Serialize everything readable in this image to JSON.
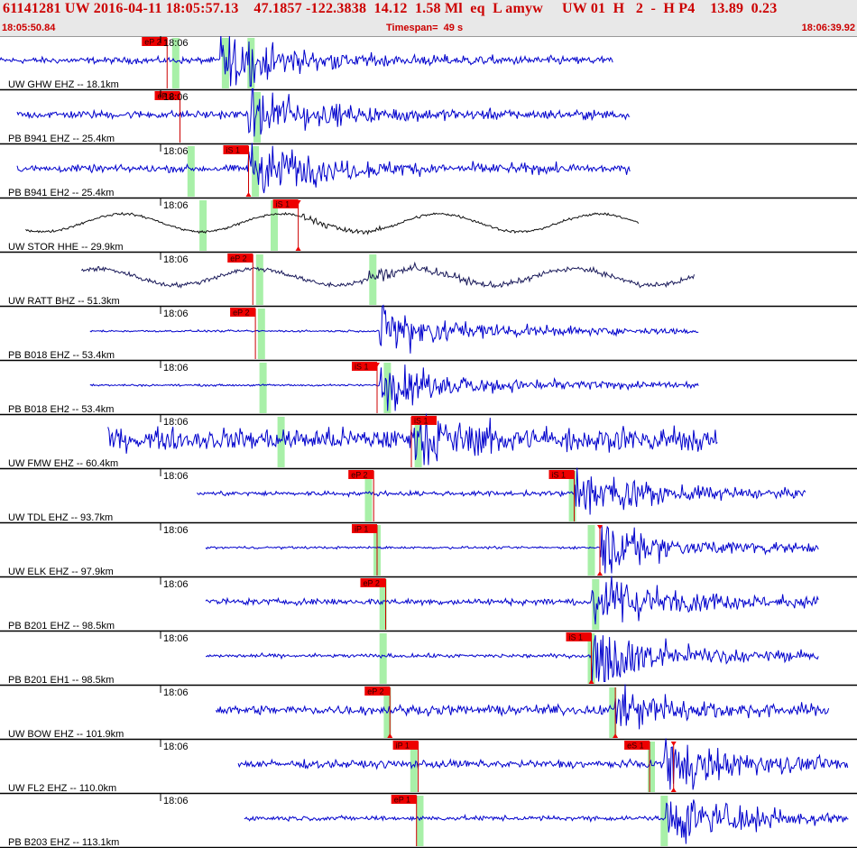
{
  "header": {
    "event_line": "61141281 UW 2016-04-11 18:05:57.13    47.1857 -122.3838  14.12  1.58 Ml  eq  L amyw     UW 01  H   2  -  H P4    13.89  0.23",
    "start_time": "18:05:50.84",
    "timespan": "Timespan=  49 s",
    "end_time": "18:06:39.92"
  },
  "colors": {
    "header_text": "#cc0000",
    "seismogram_blue": "#0000cc",
    "seismogram_dark": "#1a1a5a",
    "seismogram_black": "#111111",
    "pick_fill": "#ee0000",
    "window_green": "#a8f0a8"
  },
  "traces": [
    {
      "station": "UW GHW EHZ --",
      "dist": "18.1km",
      "label": "UW GHW EHZ -- 18.1km",
      "time": "18:06",
      "color": "blue",
      "start": 0.0,
      "end": 0.715,
      "onset": 0.257,
      "amp": 0.45,
      "noise": 0.08,
      "slow": 0,
      "greens": [
        0.205,
        0.263,
        0.293
      ],
      "picks": [
        {
          "text": "eP 2",
          "t": 0.195,
          "side": "left"
        }
      ]
    },
    {
      "station": "PB B941 EHZ --",
      "dist": "25.4km",
      "label": "PB B941 EHZ -- 25.4km",
      "time": "18:06",
      "color": "blue",
      "start": 0.02,
      "end": 0.735,
      "onset": 0.29,
      "amp": 0.4,
      "noise": 0.1,
      "slow": 0,
      "greens": [
        0.3
      ],
      "picks": [
        {
          "text": "eP 2",
          "t": 0.21,
          "side": "left"
        }
      ]
    },
    {
      "station": "PB B941 EH2 --",
      "dist": "25.4km",
      "label": "PB B941 EH2 -- 25.4km",
      "time": "18:06",
      "color": "blue",
      "start": 0.02,
      "end": 0.735,
      "onset": 0.29,
      "amp": 0.45,
      "noise": 0.09,
      "slow": 0,
      "greens": [
        0.223,
        0.298
      ],
      "picks": [
        {
          "text": "iS 1",
          "t": 0.29,
          "side": "left",
          "marker": "below"
        }
      ]
    },
    {
      "station": "UW STOR HHE --",
      "dist": "29.9km",
      "label": "UW STOR HHE -- 29.9km",
      "time": "18:06",
      "color": "black",
      "start": 0.03,
      "end": 0.745,
      "onset": 0.35,
      "amp": 0.06,
      "noise": 0.03,
      "slow": 0.33,
      "greens": [
        0.237,
        0.32
      ],
      "picks": [
        {
          "text": "iS 1",
          "t": 0.348,
          "side": "left",
          "marker": "both"
        }
      ]
    },
    {
      "station": "UW RATT BHZ --",
      "dist": "51.3km",
      "label": "UW RATT BHZ -- 51.3km",
      "time": "18:06",
      "color": "dark",
      "start": 0.095,
      "end": 0.81,
      "onset": 0.43,
      "amp": 0.12,
      "noise": 0.06,
      "slow": 0.3,
      "greens": [
        0.303,
        0.435
      ],
      "picks": [
        {
          "text": "eP 2",
          "t": 0.295,
          "side": "left"
        }
      ]
    },
    {
      "station": "PB B018 EHZ --",
      "dist": "53.4km",
      "label": "PB B018 EHZ -- 53.4km",
      "time": "18:06",
      "color": "blue",
      "start": 0.105,
      "end": 0.815,
      "onset": 0.443,
      "amp": 0.38,
      "noise": 0.025,
      "slow": 0,
      "greens": [
        0.305
      ],
      "picks": [
        {
          "text": "eP 2",
          "t": 0.298,
          "side": "left"
        }
      ]
    },
    {
      "station": "PB B018 EH2 --",
      "dist": "53.4km",
      "label": "PB B018 EH2 -- 53.4km",
      "time": "18:06",
      "color": "blue",
      "start": 0.105,
      "end": 0.815,
      "onset": 0.443,
      "amp": 0.4,
      "noise": 0.025,
      "slow": 0,
      "greens": [
        0.307,
        0.452
      ],
      "picks": [
        {
          "text": "iS 1",
          "t": 0.44,
          "side": "left",
          "marker": "above"
        }
      ]
    },
    {
      "station": "UW FMW EHZ --",
      "dist": "60.4km",
      "label": "UW FMW EHZ -- 60.4km",
      "time": "18:06",
      "color": "blue",
      "start": 0.126,
      "end": 0.838,
      "onset": 0.48,
      "amp": 0.4,
      "noise": 0.28,
      "slow": 0,
      "greens": [
        0.328,
        0.488
      ],
      "picks": [
        {
          "text": "iS 1",
          "t": 0.48,
          "side": "right"
        }
      ]
    },
    {
      "station": "UW TDL EHZ --",
      "dist": "93.7km",
      "label": "UW TDL EHZ -- 93.7km",
      "time": "18:06",
      "color": "blue",
      "start": 0.23,
      "end": 0.94,
      "onset": 0.67,
      "amp": 0.4,
      "noise": 0.06,
      "slow": 0,
      "greens": [
        0.43,
        0.668
      ],
      "picks": [
        {
          "text": "eP 2",
          "t": 0.436,
          "side": "left"
        },
        {
          "text": "iS 1",
          "t": 0.67,
          "side": "left"
        }
      ]
    },
    {
      "station": "UW ELK EHZ --",
      "dist": "97.9km",
      "label": "UW ELK EHZ -- 97.9km",
      "time": "18:06",
      "color": "blue",
      "start": 0.24,
      "end": 0.955,
      "onset": 0.7,
      "amp": 0.42,
      "noise": 0.03,
      "slow": 0,
      "greens": [
        0.44,
        0.69
      ],
      "picks": [
        {
          "text": "iP 1",
          "t": 0.44,
          "side": "left"
        },
        {
          "text": "",
          "t": 0.7,
          "side": "left",
          "marker": "both"
        }
      ]
    },
    {
      "station": "PB B201 EHZ --",
      "dist": "98.5km",
      "label": "PB B201 EHZ -- 98.5km",
      "time": "18:06",
      "color": "blue",
      "start": 0.24,
      "end": 0.955,
      "onset": 0.69,
      "amp": 0.45,
      "noise": 0.08,
      "slow": 0,
      "greens": [
        0.447,
        0.695
      ],
      "picks": [
        {
          "text": "eP 2",
          "t": 0.45,
          "side": "left"
        }
      ]
    },
    {
      "station": "PB B201 EH1 --",
      "dist": "98.5km",
      "label": "PB B201 EH1 -- 98.5km",
      "time": "18:06",
      "color": "blue",
      "start": 0.24,
      "end": 0.955,
      "onset": 0.69,
      "amp": 0.45,
      "noise": 0.05,
      "slow": 0,
      "greens": [
        0.447,
        0.69
      ],
      "picks": [
        {
          "text": "iS 1",
          "t": 0.69,
          "side": "left",
          "marker": "below"
        }
      ]
    },
    {
      "station": "UW BOW EHZ --",
      "dist": "101.9km",
      "label": "UW BOW EHZ -- 101.9km",
      "time": "18:06",
      "color": "blue",
      "start": 0.252,
      "end": 0.968,
      "onset": 0.718,
      "amp": 0.35,
      "noise": 0.12,
      "slow": 0,
      "greens": [
        0.452,
        0.715
      ],
      "picks": [
        {
          "text": "eP 2",
          "t": 0.455,
          "side": "left",
          "marker": "below"
        },
        {
          "text": "",
          "t": 0.718,
          "side": "left",
          "marker": "below"
        }
      ]
    },
    {
      "station": "UW FL2 EHZ --",
      "dist": "110.0km",
      "label": "UW FL2 EHZ -- 110.0km",
      "time": "18:06",
      "color": "blue",
      "start": 0.278,
      "end": 0.99,
      "onset": 0.775,
      "amp": 0.42,
      "noise": 0.1,
      "slow": 0,
      "greens": [
        0.483,
        0.76
      ],
      "picks": [
        {
          "text": "iP 1",
          "t": 0.488,
          "side": "left"
        },
        {
          "text": "eS 1",
          "t": 0.758,
          "side": "left"
        },
        {
          "text": "",
          "t": 0.786,
          "side": "left",
          "marker": "both"
        }
      ]
    },
    {
      "station": "PB B203 EHZ --",
      "dist": "113.1km",
      "label": "PB B203 EHZ -- 113.1km",
      "time": "18:06",
      "color": "blue",
      "start": 0.285,
      "end": 0.99,
      "onset": 0.777,
      "amp": 0.45,
      "noise": 0.06,
      "slow": 0,
      "greens": [
        0.49,
        0.775
      ],
      "picks": [
        {
          "text": "eP 1",
          "t": 0.486,
          "side": "left"
        }
      ]
    }
  ]
}
